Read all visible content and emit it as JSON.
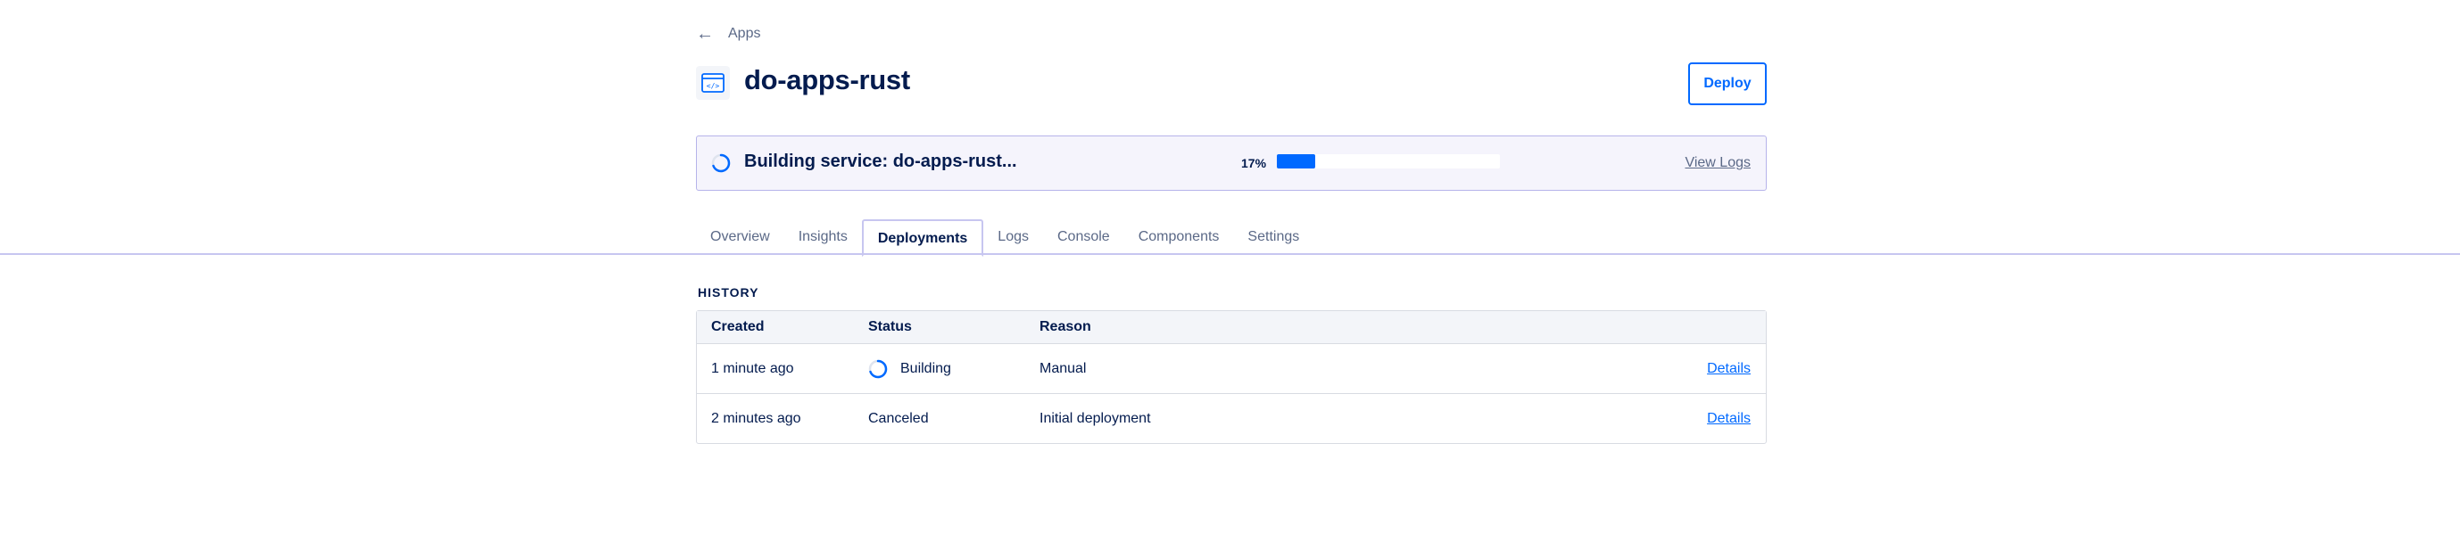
{
  "breadcrumb": {
    "back_icon": "back-arrow-icon",
    "label": "Apps"
  },
  "header": {
    "title": "do-apps-rust",
    "icon": "code-window-icon",
    "deploy_label": "Deploy"
  },
  "build_status": {
    "text": "Building service: do-apps-rust...",
    "percent_label": "17%",
    "progress": 0.17,
    "view_logs_label": "View Logs"
  },
  "tabs": [
    {
      "label": "Overview",
      "active": false
    },
    {
      "label": "Insights",
      "active": false
    },
    {
      "label": "Deployments",
      "active": true
    },
    {
      "label": "Logs",
      "active": false
    },
    {
      "label": "Console",
      "active": false
    },
    {
      "label": "Components",
      "active": false
    },
    {
      "label": "Settings",
      "active": false
    }
  ],
  "history": {
    "title": "HISTORY",
    "columns": {
      "created": "Created",
      "status": "Status",
      "reason": "Reason"
    },
    "rows": [
      {
        "created": "1 minute ago",
        "status": "Building",
        "reason": "Manual",
        "action": "Details"
      },
      {
        "created": "2 minutes ago",
        "status": "Canceled",
        "reason": "Initial deployment",
        "action": "Details"
      }
    ]
  },
  "colors": {
    "accent": "#0069ff",
    "text": "#031b4e",
    "muted": "#5b6987",
    "bar_bg": "#f5f4fc",
    "bar_border": "#b6b3ea"
  }
}
